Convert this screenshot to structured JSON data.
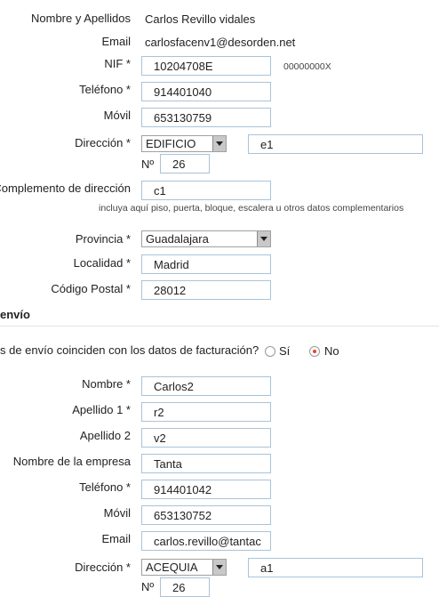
{
  "billing": {
    "name_label": "Nombre y Apellidos",
    "name_value": "Carlos Revillo vidales",
    "email_label": "Email",
    "email_value": "carlosfacenv1@desorden.net",
    "nif_label": "NIF *",
    "nif_value": "10204708E",
    "nif_hint": "00000000X",
    "phone_label": "Teléfono *",
    "phone_value": "914401040",
    "mobile_label": "Móvil",
    "mobile_value": "653130759",
    "address_label": "Dirección *",
    "street_type": "EDIFICIO",
    "street_name": "e1",
    "number_label": "Nº",
    "number_value": "26",
    "complement_label": "Complemento de dirección",
    "complement_value": "c1",
    "complement_hint": "incluya aquí piso, puerta, bloque, escalera u otros datos complementarios",
    "province_label": "Provincia *",
    "province_value": "Guadalajara",
    "city_label": "Localidad *",
    "city_value": "Madrid",
    "postal_label": "Código Postal *",
    "postal_value": "28012"
  },
  "shipping": {
    "section_title": "envío",
    "question": "s de envío coinciden con los datos de facturación?",
    "yes_label": "Sí",
    "no_label": "No",
    "selected": "No",
    "firstname_label": "Nombre *",
    "firstname_value": "Carlos2",
    "lastname1_label": "Apellido 1 *",
    "lastname1_value": "r2",
    "lastname2_label": "Apellido 2",
    "lastname2_value": "v2",
    "company_label": "Nombre de la empresa",
    "company_value": "Tanta",
    "phone_label": "Teléfono *",
    "phone_value": "914401042",
    "mobile_label": "Móvil",
    "mobile_value": "653130752",
    "email_label": "Email",
    "email_value": "carlos.revillo@tantac",
    "address_label": "Dirección *",
    "street_type": "ACEQUIA",
    "street_name": "a1",
    "number_label": "Nº",
    "number_value": "26"
  },
  "colors": {
    "input_border": "#a9c3d9",
    "radio_selected": "#e0452b"
  }
}
